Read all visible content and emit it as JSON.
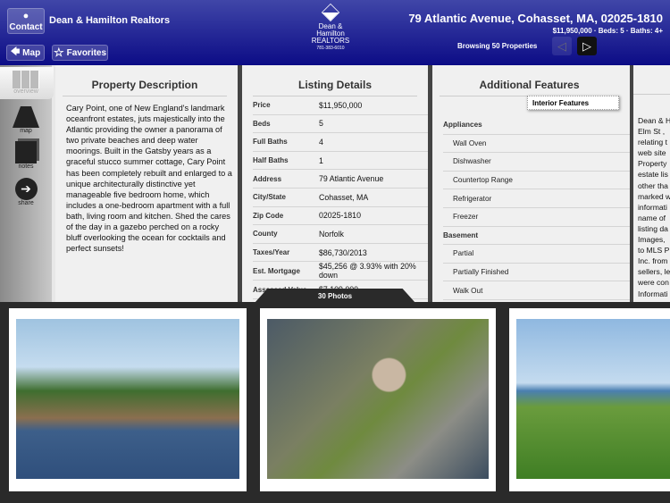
{
  "header": {
    "contact_label": "Contact",
    "agent_name": "Dean & Hamilton Realtors",
    "map_label": "Map",
    "favorites_label": "Favorites",
    "logo": {
      "line1": "Dean &",
      "line2": "Hamilton",
      "line3": "REALTORS",
      "phone": "781-383-6010"
    },
    "address": "79 Atlantic Avenue, Cohasset, MA, 02025-1810",
    "summary": "$11,950,000 · Beds: 5 · Baths: 4+",
    "browsing": "Browsing 50 Properties",
    "previous_label": "Previous",
    "next_label": "Next"
  },
  "sidebar": {
    "items": [
      {
        "label": "overview",
        "icon": "grid-icon"
      },
      {
        "label": "map",
        "icon": "road-icon"
      },
      {
        "label": "notes",
        "icon": "notes-icon"
      },
      {
        "label": "share",
        "icon": "arrow-right-circle-icon"
      }
    ]
  },
  "description": {
    "title": "Property Description",
    "text": "Cary Point, one of New England's landmark oceanfront estates, juts majestically into the Atlantic providing the owner a panorama of two private beaches and deep water moorings. Built in the Gatsby years as a graceful stucco summer cottage, Cary Point has been completely rebuilt and enlarged to a unique architecturally distinctive yet manageable five bedroom home, which includes a one-bedroom apartment with a full bath, living room and kitchen. Shed the cares of the day in a gazebo perched on a rocky bluff overlooking the ocean for cocktails and perfect sunsets!"
  },
  "details": {
    "title": "Listing Details",
    "rows": [
      {
        "k": "Price",
        "v": "$11,950,000"
      },
      {
        "k": "Beds",
        "v": "5"
      },
      {
        "k": "Full Baths",
        "v": "4"
      },
      {
        "k": "Half Baths",
        "v": "1"
      },
      {
        "k": "Address",
        "v": "79 Atlantic Avenue"
      },
      {
        "k": "City/State",
        "v": "Cohasset, MA"
      },
      {
        "k": "Zip Code",
        "v": "02025-1810"
      },
      {
        "k": "County",
        "v": "Norfolk"
      },
      {
        "k": "Taxes/Year",
        "v": "$86,730/2013"
      },
      {
        "k": "Est. Mortgage",
        "v": "$45,256 @ 3.93% with 20% down"
      },
      {
        "k": "Assessed Value",
        "v": "$7,109,000"
      }
    ]
  },
  "features": {
    "title": "Additional Features",
    "selector": "Interior Features",
    "rows": [
      {
        "t": "Appliances",
        "cat": true
      },
      {
        "t": "Wall Oven"
      },
      {
        "t": "Dishwasher"
      },
      {
        "t": "Countertop Range"
      },
      {
        "t": "Refrigerator"
      },
      {
        "t": "Freezer"
      },
      {
        "t": "Basement",
        "cat": true
      },
      {
        "t": "Partial"
      },
      {
        "t": "Partially Finished"
      },
      {
        "t": "Walk Out"
      }
    ]
  },
  "disclaimer": {
    "lines": [
      "Dean & H",
      "Elm St ,",
      "relating t",
      "web site",
      "Property",
      "estate lis",
      "other tha",
      "marked w",
      "informati",
      "name of",
      "listing da",
      "Images,",
      "to MLS P",
      "Inc. from",
      "sellers, le",
      "were con",
      "Informati"
    ]
  },
  "gallery": {
    "count_label": "30 Photos"
  }
}
